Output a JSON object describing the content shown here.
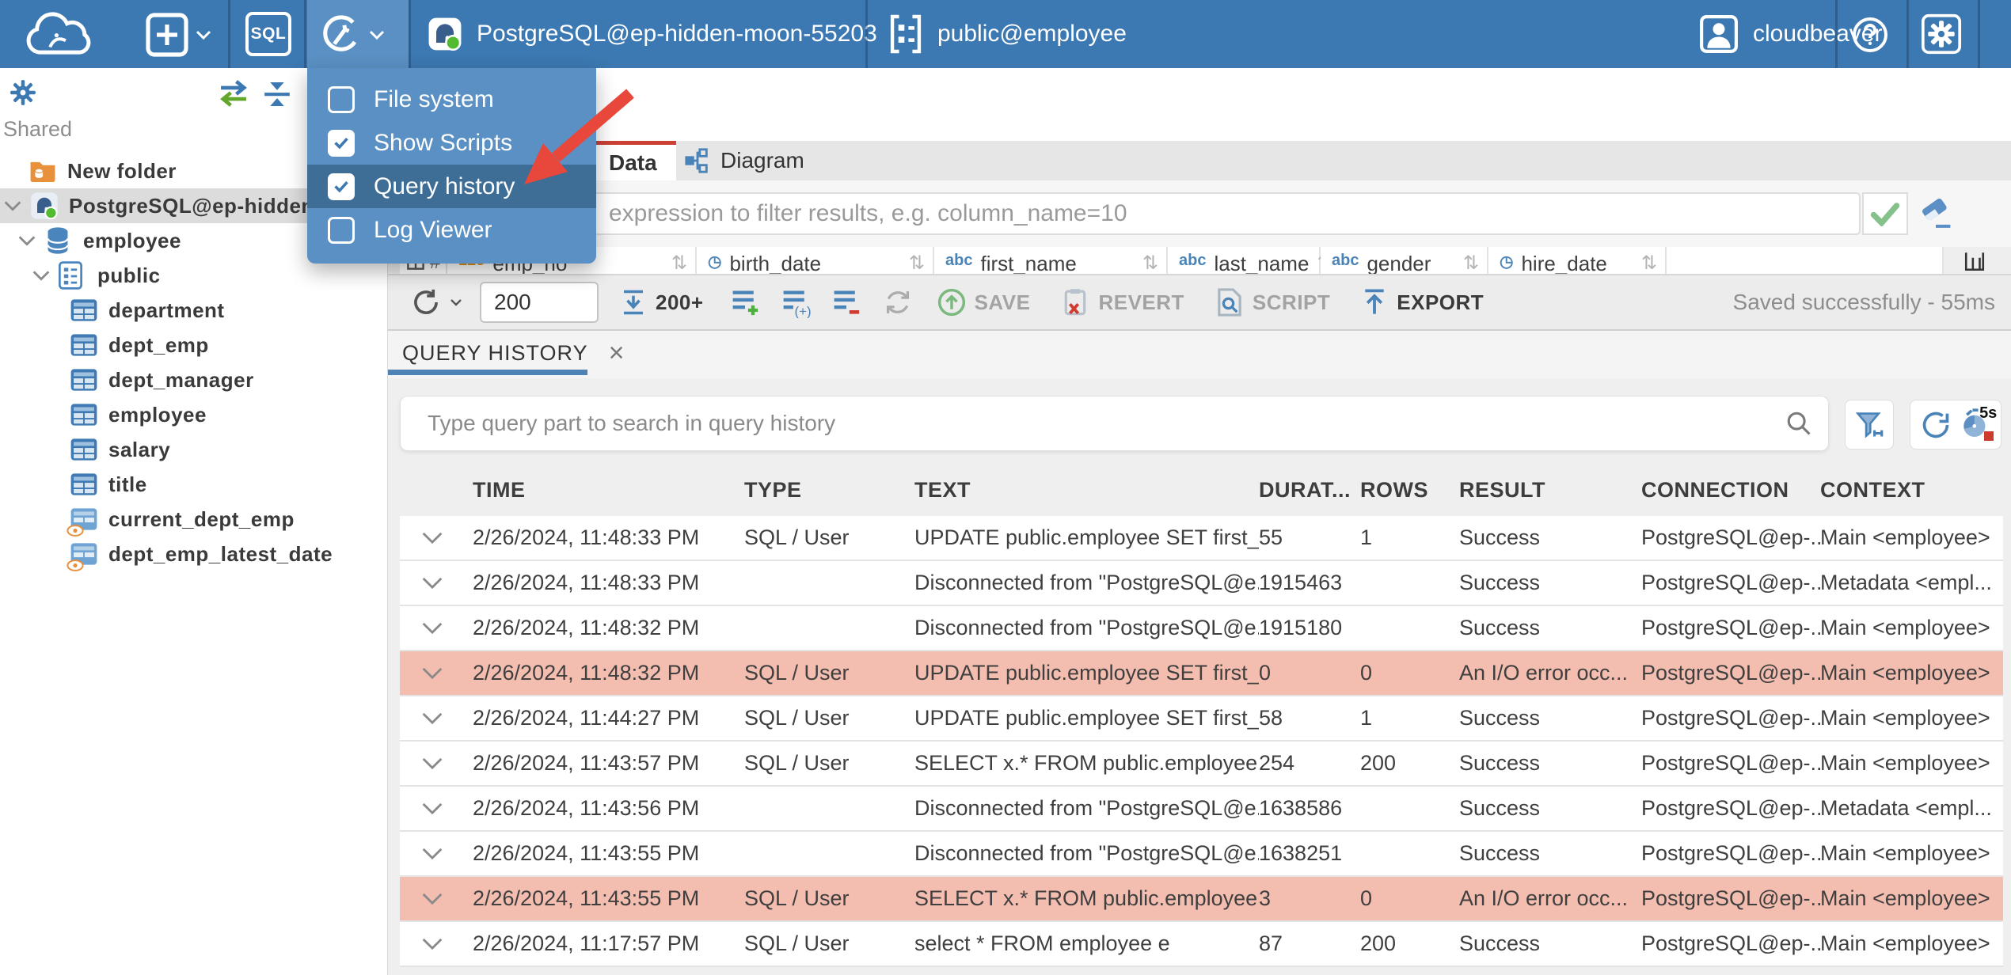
{
  "topbar": {
    "sql_label": "SQL",
    "connection_label": "PostgreSQL@ep-hidden-moon-55203",
    "schema_label": "public@employee",
    "username": "cloudbeaver"
  },
  "tools_menu": {
    "items": [
      {
        "label": "File system",
        "checked": false,
        "highlighted": false
      },
      {
        "label": "Show Scripts",
        "checked": true,
        "highlighted": false
      },
      {
        "label": "Query history",
        "checked": true,
        "highlighted": true
      },
      {
        "label": "Log Viewer",
        "checked": false,
        "highlighted": false
      }
    ]
  },
  "sidebar": {
    "section_label": "Shared",
    "tree": [
      {
        "label": "New folder"
      },
      {
        "label": "PostgreSQL@ep-hidden-moon-55203",
        "selected": true
      },
      {
        "label": "employee"
      },
      {
        "label": "public"
      },
      {
        "label": "department"
      },
      {
        "label": "dept_emp"
      },
      {
        "label": "dept_manager"
      },
      {
        "label": "employee"
      },
      {
        "label": "salary"
      },
      {
        "label": "title"
      },
      {
        "label": "current_dept_emp"
      },
      {
        "label": "dept_emp_latest_date"
      }
    ]
  },
  "main": {
    "tabs": [
      {
        "label": "Data",
        "active": true
      },
      {
        "label": "Diagram",
        "active": false
      }
    ],
    "filter_placeholder": "expression to filter results, e.g. column_name=10",
    "grid_corner": "#",
    "sort_glyph": "⇅",
    "grid_columns": [
      {
        "name": "emp_no",
        "glyph": "123"
      },
      {
        "name": "birth_date",
        "glyph": "◷"
      },
      {
        "name": "first_name",
        "glyph": "abc"
      },
      {
        "name": "last_name",
        "glyph": "abc"
      },
      {
        "name": "gender",
        "glyph": "abc"
      },
      {
        "name": "hire_date",
        "glyph": "◷"
      }
    ],
    "toolbar": {
      "row_limit": "200",
      "fetch_label": "200+",
      "save_label": "SAVE",
      "revert_label": "REVERT",
      "script_label": "SCRIPT",
      "export_label": "EXPORT",
      "status": "Saved successfully - 55ms"
    }
  },
  "query_history": {
    "tab_label": "QUERY HISTORY",
    "close_glyph": "×",
    "search_placeholder": "Type query part to search in query history",
    "refresh_interval_label": "5s",
    "columns": [
      "TIME",
      "TYPE",
      "TEXT",
      "DURAT...",
      "ROWS",
      "RESULT",
      "CONNECTION",
      "CONTEXT"
    ],
    "rows": [
      {
        "time": "2/26/2024, 11:48:33 PM",
        "type": "SQL / User",
        "text": "UPDATE public.employee SET first_...",
        "duration": "55",
        "rows": "1",
        "result": "Success",
        "connection": "PostgreSQL@ep-...",
        "context": "Main <employee>",
        "error": false
      },
      {
        "time": "2/26/2024, 11:48:33 PM",
        "type": "",
        "text": "Disconnected from \"PostgreSQL@e...",
        "duration": "1915463",
        "rows": "",
        "result": "Success",
        "connection": "PostgreSQL@ep-...",
        "context": "Metadata <empl...",
        "error": false
      },
      {
        "time": "2/26/2024, 11:48:32 PM",
        "type": "",
        "text": "Disconnected from \"PostgreSQL@e...",
        "duration": "1915180",
        "rows": "",
        "result": "Success",
        "connection": "PostgreSQL@ep-...",
        "context": "Main <employee>",
        "error": false
      },
      {
        "time": "2/26/2024, 11:48:32 PM",
        "type": "SQL / User",
        "text": "UPDATE public.employee SET first_...",
        "duration": "0",
        "rows": "0",
        "result": "An I/O error occ...",
        "connection": "PostgreSQL@ep-...",
        "context": "Main <employee>",
        "error": true
      },
      {
        "time": "2/26/2024, 11:44:27 PM",
        "type": "SQL / User",
        "text": "UPDATE public.employee SET first_...",
        "duration": "58",
        "rows": "1",
        "result": "Success",
        "connection": "PostgreSQL@ep-...",
        "context": "Main <employee>",
        "error": false
      },
      {
        "time": "2/26/2024, 11:43:57 PM",
        "type": "SQL / User",
        "text": "SELECT x.* FROM public.employee x",
        "duration": "254",
        "rows": "200",
        "result": "Success",
        "connection": "PostgreSQL@ep-...",
        "context": "Main <employee>",
        "error": false
      },
      {
        "time": "2/26/2024, 11:43:56 PM",
        "type": "",
        "text": "Disconnected from \"PostgreSQL@e...",
        "duration": "1638586",
        "rows": "",
        "result": "Success",
        "connection": "PostgreSQL@ep-...",
        "context": "Metadata <empl...",
        "error": false
      },
      {
        "time": "2/26/2024, 11:43:55 PM",
        "type": "",
        "text": "Disconnected from \"PostgreSQL@e...",
        "duration": "1638251",
        "rows": "",
        "result": "Success",
        "connection": "PostgreSQL@ep-...",
        "context": "Main <employee>",
        "error": false
      },
      {
        "time": "2/26/2024, 11:43:55 PM",
        "type": "SQL / User",
        "text": "SELECT x.* FROM public.employee x",
        "duration": "3",
        "rows": "0",
        "result": "An I/O error occ...",
        "connection": "PostgreSQL@ep-...",
        "context": "Main <employee>",
        "error": true
      },
      {
        "time": "2/26/2024, 11:17:57 PM",
        "type": "SQL / User",
        "text": "select * FROM employee e",
        "duration": "87",
        "rows": "200",
        "result": "Success",
        "connection": "PostgreSQL@ep-...",
        "context": "Main <employee>",
        "error": false
      }
    ]
  }
}
